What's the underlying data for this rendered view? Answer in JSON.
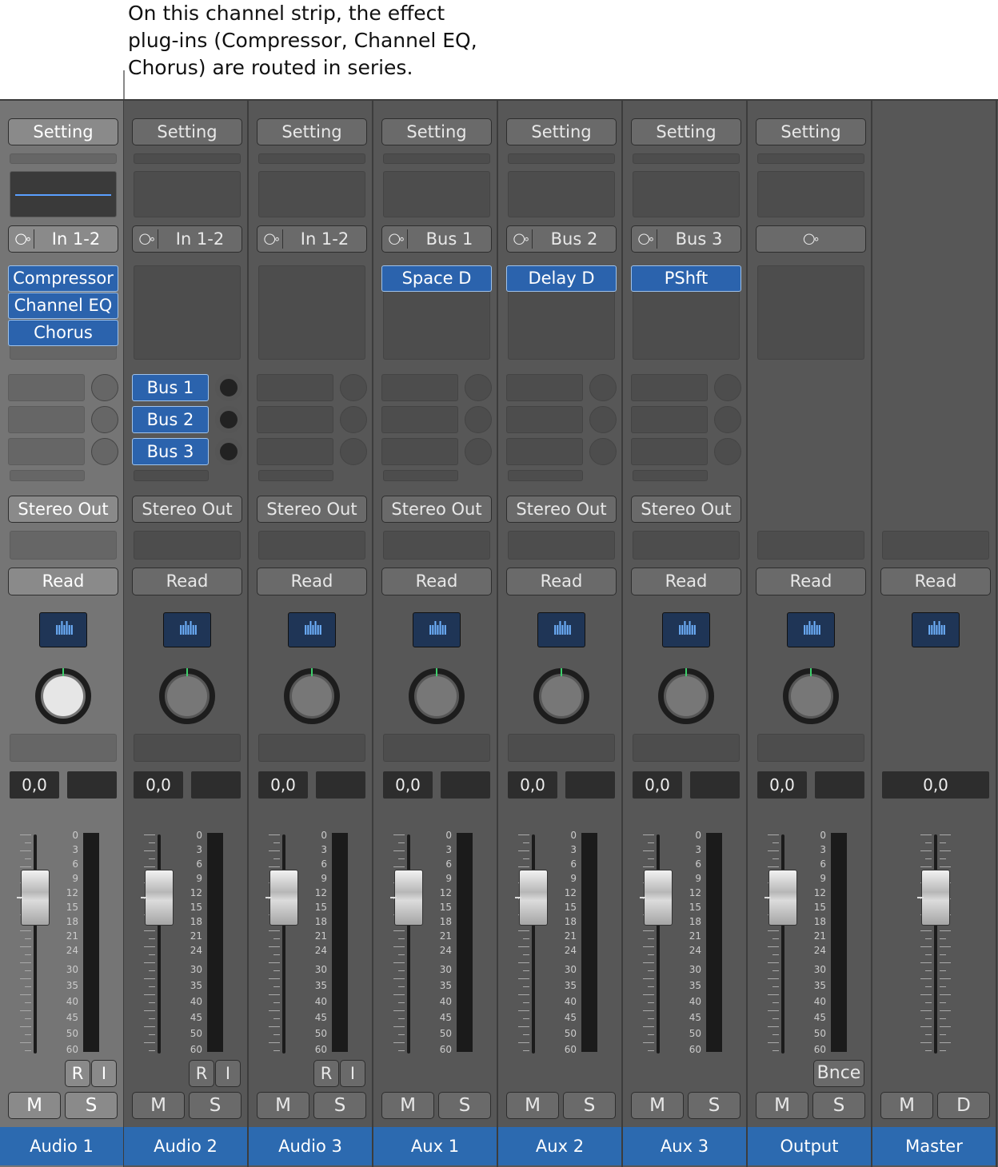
{
  "callout": "On this channel strip, the effect\nplug-ins (Compressor, Channel EQ,\nChorus) are routed in series.",
  "common": {
    "setting_label": "Setting",
    "read_label": "Read",
    "volume_value": "0,0",
    "mute_label": "M",
    "solo_label": "S",
    "dim_label": "D",
    "record_label": "R",
    "input_label": "I",
    "bounce_label": "Bnce",
    "stereo_link_icon": "link-rings-icon",
    "waveform_icon": "waveform-icon"
  },
  "meter_scale": [
    "0",
    "3",
    "6",
    "9",
    "12",
    "15",
    "18",
    "21",
    "24",
    "30",
    "35",
    "40",
    "45",
    "50",
    "60"
  ],
  "strips": [
    {
      "name": "Audio 1",
      "input": "In 1-2",
      "plugins": [
        "Compressor",
        "Channel EQ",
        "Chorus"
      ],
      "sends": [],
      "output": "Stereo Out",
      "selected": true
    },
    {
      "name": "Audio 2",
      "input": "In 1-2",
      "plugins": [],
      "sends": [
        "Bus 1",
        "Bus 2",
        "Bus 3"
      ],
      "output": "Stereo Out"
    },
    {
      "name": "Audio 3",
      "input": "In 1-2",
      "plugins": [],
      "sends": [],
      "output": "Stereo Out"
    },
    {
      "name": "Aux 1",
      "input": "Bus 1",
      "plugins": [
        "Space D"
      ],
      "sends": [],
      "output": "Stereo Out"
    },
    {
      "name": "Aux 2",
      "input": "Bus 2",
      "plugins": [
        "Delay D"
      ],
      "sends": [],
      "output": "Stereo Out"
    },
    {
      "name": "Aux 3",
      "input": "Bus 3",
      "plugins": [
        "PShft"
      ],
      "sends": [],
      "output": "Stereo Out"
    },
    {
      "name": "Output",
      "input": "",
      "plugins": [],
      "sends": [],
      "output": ""
    },
    {
      "name": "Master",
      "input": "",
      "plugins": [],
      "sends": [],
      "output": ""
    }
  ]
}
